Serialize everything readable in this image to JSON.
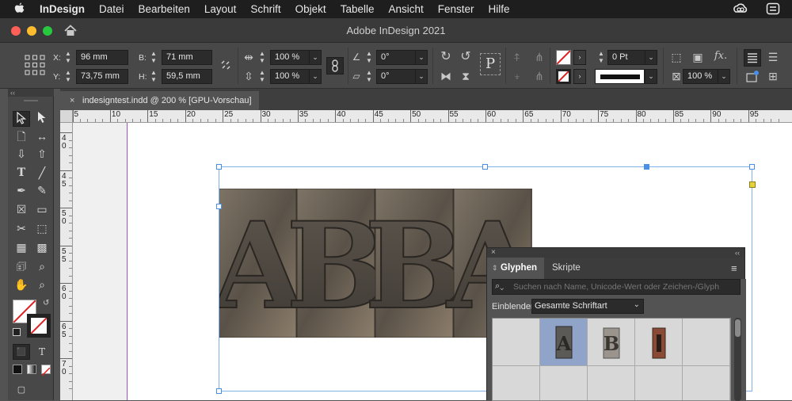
{
  "menubar": {
    "app_name": "InDesign",
    "items": [
      "Datei",
      "Bearbeiten",
      "Layout",
      "Schrift",
      "Objekt",
      "Tabelle",
      "Ansicht",
      "Fenster",
      "Hilfe"
    ]
  },
  "window": {
    "title": "Adobe InDesign 2021"
  },
  "control": {
    "x_label": "X:",
    "x_value": "96 mm",
    "y_label": "Y:",
    "y_value": "73,75 mm",
    "b_label": "B:",
    "b_value": "71 mm",
    "h_label": "H:",
    "h_value": "59,5 mm",
    "scale_x": "100 %",
    "scale_y": "100 %",
    "angle_rotate": "0°",
    "angle_shear": "0°",
    "stroke_weight": "0 Pt",
    "opacity": "100 %"
  },
  "document_tab": {
    "close_glyph": "×",
    "label": "indesigntest.indd @ 200 % [GPU-Vorschau]"
  },
  "ruler": {
    "h_ticks": [
      "5",
      "10",
      "15",
      "20",
      "25",
      "30",
      "35",
      "40",
      "45",
      "50",
      "55",
      "60",
      "65",
      "70",
      "75",
      "80",
      "85",
      "90",
      "95"
    ],
    "v_ticks": [
      "4\n0",
      "4\n5",
      "5\n0",
      "5\n5",
      "6\n0",
      "6\n5",
      "7\n0"
    ]
  },
  "artwork": {
    "letters": [
      "A",
      "B",
      "B",
      "A"
    ]
  },
  "glyph_panel": {
    "tabs": [
      "Glyphen",
      "Skripte"
    ],
    "search_placeholder": "Suchen nach Name, Unicode-Wert oder Zeichen-/Glyph",
    "show_label": "Einblenden:",
    "show_value": "Gesamte Schriftart"
  },
  "colors": {
    "accent": "#4a8fe7",
    "selection": "#7fb0e8",
    "menubar": "#1e1e1e"
  }
}
